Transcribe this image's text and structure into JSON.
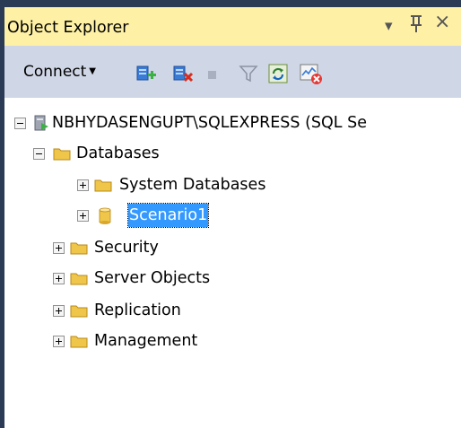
{
  "panel": {
    "title": "Object Explorer",
    "dropdown_glyph": "▾",
    "pin_glyph": "Ⅱ",
    "close_glyph": "×"
  },
  "toolbar": {
    "connect_label": "Connect",
    "connect_caret": "▼",
    "buttons": [
      {
        "icon": "connect-server-icon"
      },
      {
        "icon": "disconnect-server-icon"
      },
      {
        "icon": "stop-icon"
      },
      {
        "icon": "filter-icon"
      },
      {
        "icon": "refresh-icon"
      },
      {
        "icon": "activity-monitor-icon"
      }
    ]
  },
  "tree": {
    "server": "NBHYDASENGUPT\\SQLEXPRESS (SQL Se",
    "databases": "Databases",
    "system_databases": "System Databases",
    "selected_database": "Scenario1",
    "security": "Security",
    "server_objects": "Server Objects",
    "replication": "Replication",
    "management": "Management"
  },
  "colors": {
    "titlebar": "#fef1a6",
    "toolbar": "#cfd6e5",
    "selection": "#3399ff",
    "folder": "#f0c64a",
    "frame": "#2b3a55"
  }
}
